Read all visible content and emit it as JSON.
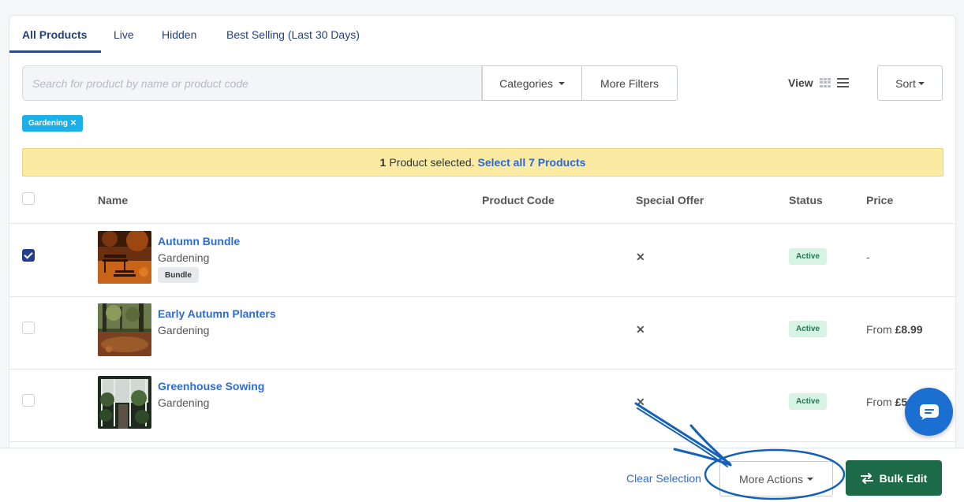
{
  "tabs": [
    {
      "label": "All Products",
      "active": true
    },
    {
      "label": "Live",
      "active": false
    },
    {
      "label": "Hidden",
      "active": false
    },
    {
      "label": "Best Selling (Last 30 Days)",
      "active": false
    }
  ],
  "search": {
    "placeholder": "Search for product by name or product code",
    "value": ""
  },
  "filters": {
    "categories_label": "Categories",
    "more_filters_label": "More Filters"
  },
  "view": {
    "label": "View",
    "grid_icon": "grid-icon",
    "list_icon": "list-icon"
  },
  "sort": {
    "label": "Sort"
  },
  "active_tags": [
    {
      "label": "Gardening ✕"
    }
  ],
  "selection_banner": {
    "count": "1",
    "text": "Product selected.",
    "select_all_label": "Select all 7 Products"
  },
  "table": {
    "headers": {
      "name": "Name",
      "product_code": "Product Code",
      "special_offer": "Special Offer",
      "status": "Status",
      "price": "Price"
    },
    "rows": [
      {
        "name": "Autumn Bundle",
        "category": "Gardening",
        "badge": "Bundle",
        "special_offer": "✕",
        "status": "Active",
        "price_prefix": "",
        "price": "-",
        "checked": true
      },
      {
        "name": "Early Autumn Planters",
        "category": "Gardening",
        "badge": "",
        "special_offer": "✕",
        "status": "Active",
        "price_prefix": "From ",
        "price": "£8.99",
        "checked": false
      },
      {
        "name": "Greenhouse Sowing",
        "category": "Gardening",
        "badge": "",
        "special_offer": "✕",
        "status": "Active",
        "price_prefix": "From ",
        "price": "£5",
        "checked": false
      }
    ]
  },
  "footer": {
    "clear_selection_label": "Clear Selection",
    "more_actions_label": "More Actions",
    "bulk_edit_label": "Bulk Edit"
  },
  "colors": {
    "primary": "#2d4a8a",
    "link": "#2d6bd8",
    "banner_bg": "#fbeaa2",
    "success": "#1c6a48",
    "tag": "#1ab0ea",
    "annotation": "#1560b8"
  }
}
